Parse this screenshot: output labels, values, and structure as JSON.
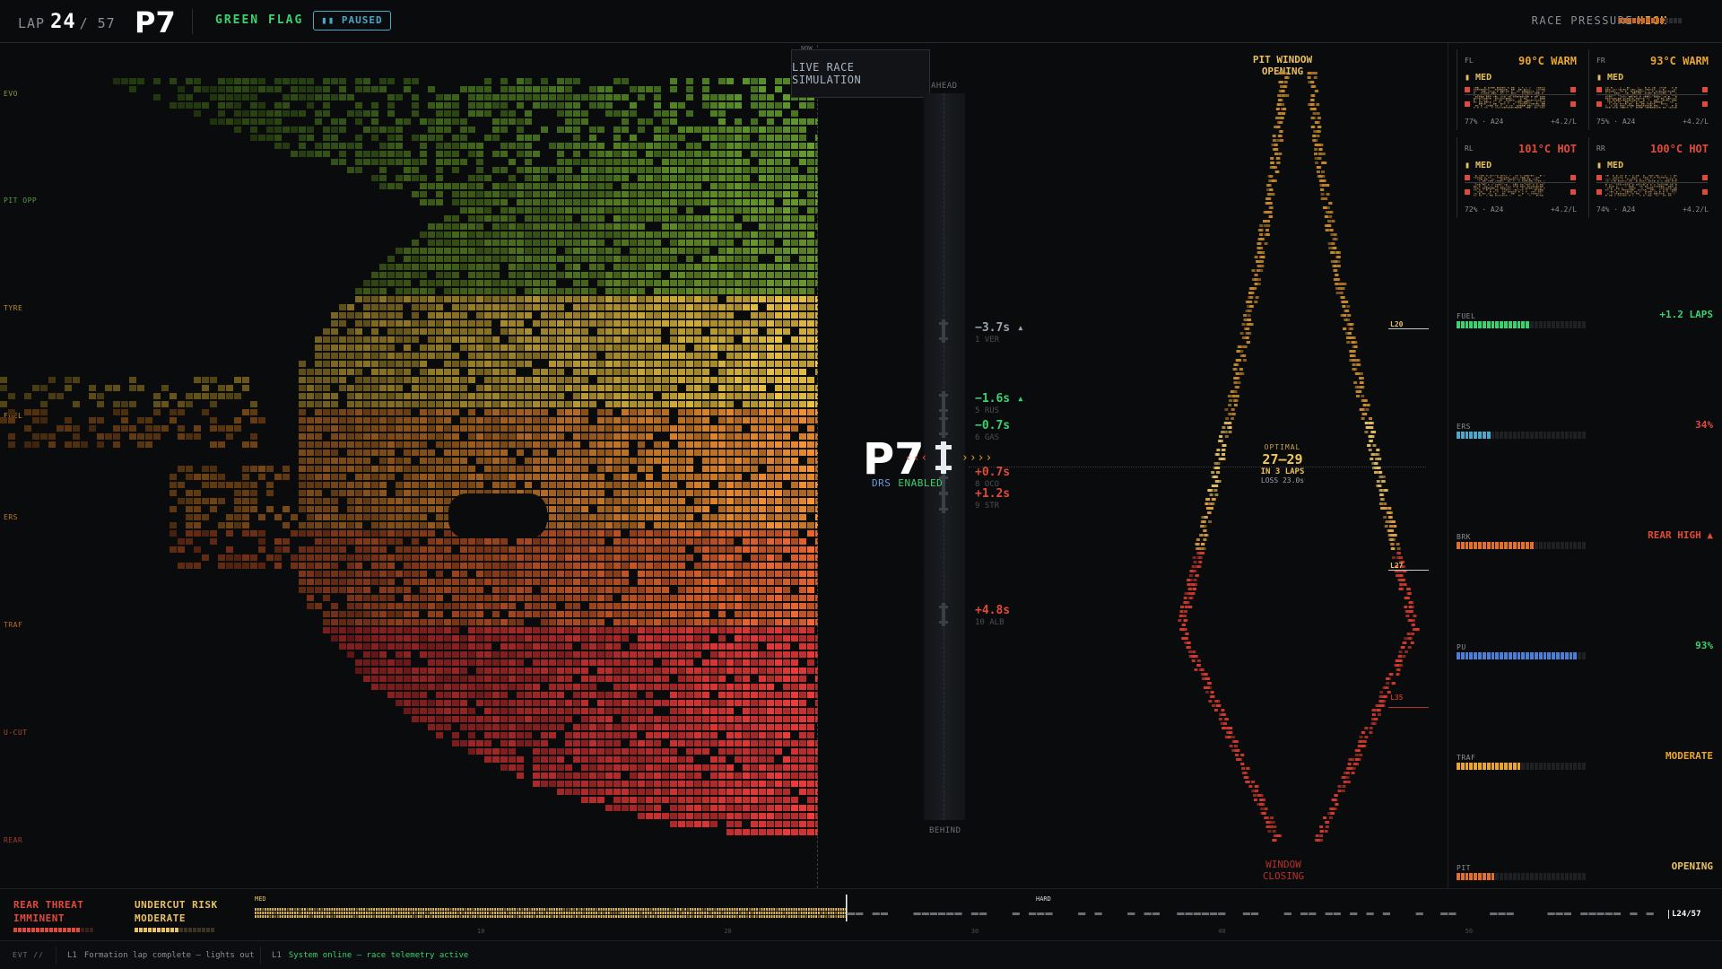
{
  "header": {
    "lap_label": "LAP",
    "lap_current": "24",
    "lap_total": "/ 57",
    "position": "P7",
    "flag": "GREEN FLAG",
    "paused_label": "▮▮ PAUSED",
    "pressure_label": "RACE PRESSURE",
    "pressure_level": "HIGH",
    "pressure_fill": 0.7
  },
  "left_labels": [
    "EVO",
    "PIT OPP",
    "TYRE",
    "FUEL",
    "ERS",
    "TRAF",
    "U-CUT",
    "REAR"
  ],
  "timeline": {
    "now_label": "NOW",
    "sim_tooltip": "LIVE RACE SIMULATION"
  },
  "track": {
    "ahead_label": "AHEAD",
    "behind_label": "BEHIND",
    "my_position": "P7",
    "drs_label": "DRS",
    "drs_state": "ENABLED",
    "left_chevrons": "‹‹‹",
    "right_chevrons": "››››",
    "gaps": [
      {
        "value": "−3.7s ▴",
        "who": "1 VER",
        "color": "#9aa3ad"
      },
      {
        "value": "−1.6s ▴",
        "who": "5 RUS",
        "color": "#3bd16f"
      },
      {
        "value": "−0.7s",
        "who": "6 GAS",
        "color": "#3bd16f"
      },
      {
        "value": "+0.7s",
        "who": "8 OCO",
        "color": "#e04a3a"
      },
      {
        "value": "+1.2s",
        "who": "9 STR",
        "color": "#e04a3a"
      },
      {
        "value": "+4.8s",
        "who": "10 ALB",
        "color": "#e04a3a"
      }
    ]
  },
  "pit_window": {
    "title_line1": "PIT WINDOW",
    "title_line2": "OPENING",
    "close_line1": "WINDOW",
    "close_line2": "CLOSING",
    "optimal_label": "OPTIMAL",
    "optimal_laps": "27–29",
    "in_laps": "IN 3 LAPS",
    "loss": "LOSS 23.0s",
    "lap_markers": [
      "L20",
      "L27",
      "L35"
    ]
  },
  "tyres": [
    {
      "pos": "FL",
      "temp": "90°C WARM",
      "temp_color": "#e8a530",
      "compound": "▮ MED",
      "info": "77% · A24",
      "deg": "+4.2/L"
    },
    {
      "pos": "FR",
      "temp": "93°C WARM",
      "temp_color": "#e8a530",
      "compound": "▮ MED",
      "info": "75% · A24",
      "deg": "+4.2/L"
    },
    {
      "pos": "RL",
      "temp": "101°C HOT",
      "temp_color": "#e04a3a",
      "compound": "▮ MED",
      "info": "72% · A24",
      "deg": "+4.2/L"
    },
    {
      "pos": "RR",
      "temp": "100°C HOT",
      "temp_color": "#e04a3a",
      "compound": "▮ MED",
      "info": "74% · A24",
      "deg": "+4.2/L"
    }
  ],
  "metrics": [
    {
      "label": "FUEL",
      "value": "+1.2 LAPS",
      "value_color": "#3bd16f",
      "bar_color": "#3bd16f",
      "fill": 0.55
    },
    {
      "label": "ERS",
      "value": "34%",
      "value_color": "#e04a3a",
      "bar_color": "#4aa8c8",
      "fill": 0.28
    },
    {
      "label": "BRK",
      "value": "REAR HIGH ▲",
      "value_color": "#e04a3a",
      "bar_color": "#e0702a",
      "fill": 0.6
    },
    {
      "label": "PU",
      "value": "93%",
      "value_color": "#3bd16f",
      "bar_color": "#4a7fd8",
      "fill": 0.93
    },
    {
      "label": "TRAF",
      "value": "MODERATE",
      "value_color": "#e8a530",
      "bar_color": "#e8a530",
      "fill": 0.5
    },
    {
      "label": "PIT",
      "value": "OPENING",
      "value_color": "#e8c060",
      "bar_color": "#e0702a",
      "fill": 0.3
    }
  ],
  "bottom": {
    "threat_line1": "REAR THREAT",
    "threat_line2": "IMMINENT",
    "undercut_line1": "UNDERCUT RISK",
    "undercut_line2": "MODERATE",
    "strip_med": "MED",
    "strip_hard": "HARD",
    "strip_ticks": [
      "10",
      "20",
      "30",
      "40",
      "50"
    ],
    "lap_counter": "L24/57"
  },
  "event_log": {
    "label": "EVT //",
    "entries": [
      {
        "lap": "L1",
        "text": "Formation lap complete — lights out",
        "color": "#8a8f96"
      },
      {
        "lap": "L1",
        "text": "System online — race telemetry active",
        "color": "#3bd16f"
      }
    ]
  },
  "colors": {
    "accent_green": "#3bd16f",
    "accent_amber": "#e8c060",
    "accent_red": "#e04a3a",
    "accent_blue": "#4aa8c8"
  }
}
